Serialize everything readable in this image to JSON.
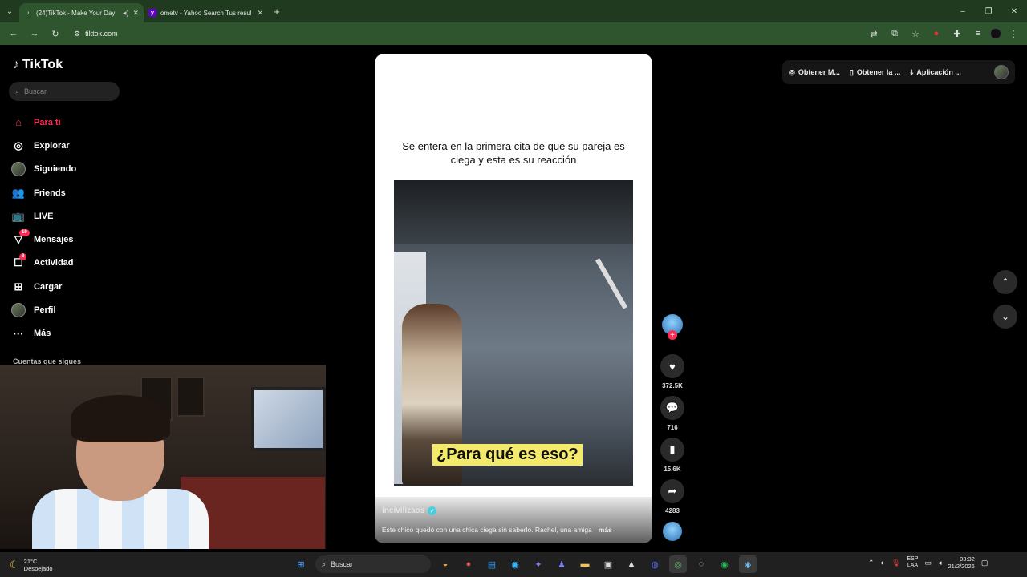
{
  "browser": {
    "tabs": [
      {
        "title": "(24)TikTok - Make Your Day",
        "active": true
      },
      {
        "title": "ometv - Yahoo Search Tus resul",
        "active": false
      }
    ],
    "url": "tiktok.com"
  },
  "sidebar": {
    "brand": "TikTok",
    "search_placeholder": "Buscar",
    "items": [
      {
        "label": "Para ti",
        "icon": "home-icon",
        "active": true
      },
      {
        "label": "Explorar",
        "icon": "compass-icon"
      },
      {
        "label": "Siguiendo",
        "icon": "following-icon"
      },
      {
        "label": "Friends",
        "icon": "friends-icon"
      },
      {
        "label": "LIVE",
        "icon": "live-icon"
      },
      {
        "label": "Mensajes",
        "icon": "messages-icon",
        "badge": "19"
      },
      {
        "label": "Actividad",
        "icon": "activity-icon",
        "badge": "8"
      },
      {
        "label": "Cargar",
        "icon": "upload-icon"
      },
      {
        "label": "Perfil",
        "icon": "profile-icon"
      },
      {
        "label": "Más",
        "icon": "more-icon"
      }
    ],
    "following_header": "Cuentas que sigues"
  },
  "topbar": {
    "get_coins": "Obtener M...",
    "get_app": "Obtener la ...",
    "desktop_app": "Aplicación ..."
  },
  "video": {
    "caption": "Se entera en la primera cita de que su pareja es ciega y esta es su reacción",
    "subtitle": "¿Para qué es eso?",
    "author": "incivilizaos",
    "description": "Este chico quedó con una chica ciega sin saberlo. Rachel, una amiga",
    "more": "más"
  },
  "actions": {
    "likes": "372.5K",
    "comments": "716",
    "saves": "15.6K",
    "shares": "4283"
  },
  "taskbar": {
    "temp": "21°C",
    "weather": "Despejado",
    "search": "Buscar",
    "lang_top": "ESP",
    "lang_bottom": "LAA",
    "time": "03:32",
    "date": "21/2/2026"
  }
}
